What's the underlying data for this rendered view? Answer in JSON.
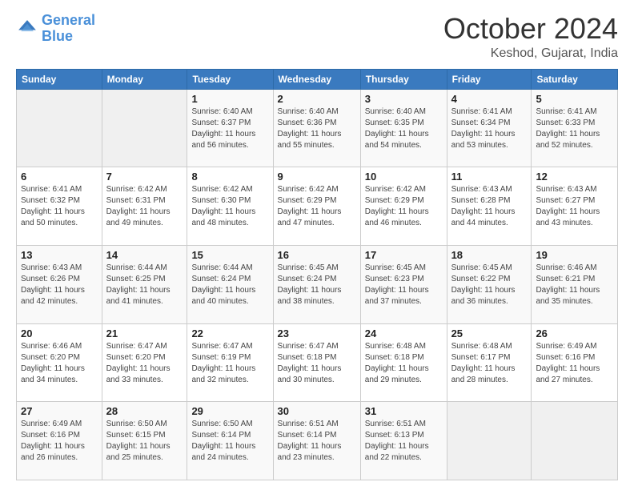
{
  "header": {
    "logo_line1": "General",
    "logo_line2": "Blue",
    "month": "October 2024",
    "location": "Keshod, Gujarat, India"
  },
  "weekdays": [
    "Sunday",
    "Monday",
    "Tuesday",
    "Wednesday",
    "Thursday",
    "Friday",
    "Saturday"
  ],
  "weeks": [
    [
      {
        "day": "",
        "sunrise": "",
        "sunset": "",
        "daylight": ""
      },
      {
        "day": "",
        "sunrise": "",
        "sunset": "",
        "daylight": ""
      },
      {
        "day": "1",
        "sunrise": "Sunrise: 6:40 AM",
        "sunset": "Sunset: 6:37 PM",
        "daylight": "Daylight: 11 hours and 56 minutes."
      },
      {
        "day": "2",
        "sunrise": "Sunrise: 6:40 AM",
        "sunset": "Sunset: 6:36 PM",
        "daylight": "Daylight: 11 hours and 55 minutes."
      },
      {
        "day": "3",
        "sunrise": "Sunrise: 6:40 AM",
        "sunset": "Sunset: 6:35 PM",
        "daylight": "Daylight: 11 hours and 54 minutes."
      },
      {
        "day": "4",
        "sunrise": "Sunrise: 6:41 AM",
        "sunset": "Sunset: 6:34 PM",
        "daylight": "Daylight: 11 hours and 53 minutes."
      },
      {
        "day": "5",
        "sunrise": "Sunrise: 6:41 AM",
        "sunset": "Sunset: 6:33 PM",
        "daylight": "Daylight: 11 hours and 52 minutes."
      }
    ],
    [
      {
        "day": "6",
        "sunrise": "Sunrise: 6:41 AM",
        "sunset": "Sunset: 6:32 PM",
        "daylight": "Daylight: 11 hours and 50 minutes."
      },
      {
        "day": "7",
        "sunrise": "Sunrise: 6:42 AM",
        "sunset": "Sunset: 6:31 PM",
        "daylight": "Daylight: 11 hours and 49 minutes."
      },
      {
        "day": "8",
        "sunrise": "Sunrise: 6:42 AM",
        "sunset": "Sunset: 6:30 PM",
        "daylight": "Daylight: 11 hours and 48 minutes."
      },
      {
        "day": "9",
        "sunrise": "Sunrise: 6:42 AM",
        "sunset": "Sunset: 6:29 PM",
        "daylight": "Daylight: 11 hours and 47 minutes."
      },
      {
        "day": "10",
        "sunrise": "Sunrise: 6:42 AM",
        "sunset": "Sunset: 6:29 PM",
        "daylight": "Daylight: 11 hours and 46 minutes."
      },
      {
        "day": "11",
        "sunrise": "Sunrise: 6:43 AM",
        "sunset": "Sunset: 6:28 PM",
        "daylight": "Daylight: 11 hours and 44 minutes."
      },
      {
        "day": "12",
        "sunrise": "Sunrise: 6:43 AM",
        "sunset": "Sunset: 6:27 PM",
        "daylight": "Daylight: 11 hours and 43 minutes."
      }
    ],
    [
      {
        "day": "13",
        "sunrise": "Sunrise: 6:43 AM",
        "sunset": "Sunset: 6:26 PM",
        "daylight": "Daylight: 11 hours and 42 minutes."
      },
      {
        "day": "14",
        "sunrise": "Sunrise: 6:44 AM",
        "sunset": "Sunset: 6:25 PM",
        "daylight": "Daylight: 11 hours and 41 minutes."
      },
      {
        "day": "15",
        "sunrise": "Sunrise: 6:44 AM",
        "sunset": "Sunset: 6:24 PM",
        "daylight": "Daylight: 11 hours and 40 minutes."
      },
      {
        "day": "16",
        "sunrise": "Sunrise: 6:45 AM",
        "sunset": "Sunset: 6:24 PM",
        "daylight": "Daylight: 11 hours and 38 minutes."
      },
      {
        "day": "17",
        "sunrise": "Sunrise: 6:45 AM",
        "sunset": "Sunset: 6:23 PM",
        "daylight": "Daylight: 11 hours and 37 minutes."
      },
      {
        "day": "18",
        "sunrise": "Sunrise: 6:45 AM",
        "sunset": "Sunset: 6:22 PM",
        "daylight": "Daylight: 11 hours and 36 minutes."
      },
      {
        "day": "19",
        "sunrise": "Sunrise: 6:46 AM",
        "sunset": "Sunset: 6:21 PM",
        "daylight": "Daylight: 11 hours and 35 minutes."
      }
    ],
    [
      {
        "day": "20",
        "sunrise": "Sunrise: 6:46 AM",
        "sunset": "Sunset: 6:20 PM",
        "daylight": "Daylight: 11 hours and 34 minutes."
      },
      {
        "day": "21",
        "sunrise": "Sunrise: 6:47 AM",
        "sunset": "Sunset: 6:20 PM",
        "daylight": "Daylight: 11 hours and 33 minutes."
      },
      {
        "day": "22",
        "sunrise": "Sunrise: 6:47 AM",
        "sunset": "Sunset: 6:19 PM",
        "daylight": "Daylight: 11 hours and 32 minutes."
      },
      {
        "day": "23",
        "sunrise": "Sunrise: 6:47 AM",
        "sunset": "Sunset: 6:18 PM",
        "daylight": "Daylight: 11 hours and 30 minutes."
      },
      {
        "day": "24",
        "sunrise": "Sunrise: 6:48 AM",
        "sunset": "Sunset: 6:18 PM",
        "daylight": "Daylight: 11 hours and 29 minutes."
      },
      {
        "day": "25",
        "sunrise": "Sunrise: 6:48 AM",
        "sunset": "Sunset: 6:17 PM",
        "daylight": "Daylight: 11 hours and 28 minutes."
      },
      {
        "day": "26",
        "sunrise": "Sunrise: 6:49 AM",
        "sunset": "Sunset: 6:16 PM",
        "daylight": "Daylight: 11 hours and 27 minutes."
      }
    ],
    [
      {
        "day": "27",
        "sunrise": "Sunrise: 6:49 AM",
        "sunset": "Sunset: 6:16 PM",
        "daylight": "Daylight: 11 hours and 26 minutes."
      },
      {
        "day": "28",
        "sunrise": "Sunrise: 6:50 AM",
        "sunset": "Sunset: 6:15 PM",
        "daylight": "Daylight: 11 hours and 25 minutes."
      },
      {
        "day": "29",
        "sunrise": "Sunrise: 6:50 AM",
        "sunset": "Sunset: 6:14 PM",
        "daylight": "Daylight: 11 hours and 24 minutes."
      },
      {
        "day": "30",
        "sunrise": "Sunrise: 6:51 AM",
        "sunset": "Sunset: 6:14 PM",
        "daylight": "Daylight: 11 hours and 23 minutes."
      },
      {
        "day": "31",
        "sunrise": "Sunrise: 6:51 AM",
        "sunset": "Sunset: 6:13 PM",
        "daylight": "Daylight: 11 hours and 22 minutes."
      },
      {
        "day": "",
        "sunrise": "",
        "sunset": "",
        "daylight": ""
      },
      {
        "day": "",
        "sunrise": "",
        "sunset": "",
        "daylight": ""
      }
    ]
  ]
}
